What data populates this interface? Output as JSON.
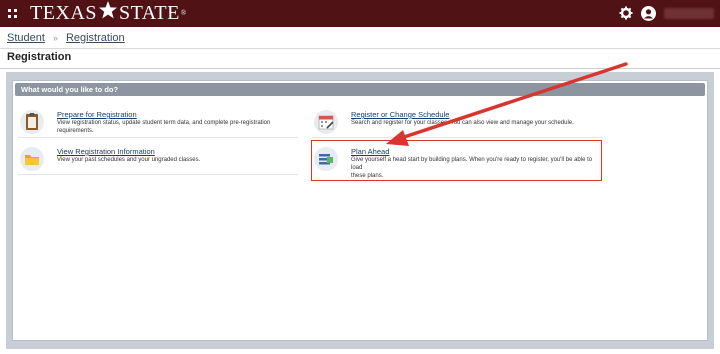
{
  "header": {
    "logo_text_left": "TEXAS",
    "logo_text_right": "STATE",
    "logo_reg": "®",
    "menu_icon": "grid-icon",
    "settings_icon": "gear-icon",
    "user_icon": "user-avatar-icon",
    "colors": {
      "maroon": "#501214"
    }
  },
  "breadcrumb": {
    "items": [
      "Student",
      "Registration"
    ],
    "separator": "»"
  },
  "page": {
    "title": "Registration",
    "section_header": "What would you like to do?"
  },
  "tasks": [
    {
      "label": "Prepare for Registration",
      "description": "View registration status, update student term data, and complete pre-registration requirements.",
      "icon": "clipboard-icon"
    },
    {
      "label": "Register or Change Schedule",
      "description": "Search and register for your classes. You can also view and manage your schedule.",
      "icon": "calendar-edit-icon"
    },
    {
      "label": "View Registration Information",
      "description": "View your past schedules and your ungraded classes.",
      "icon": "folder-icon"
    },
    {
      "label": "Plan Ahead",
      "description_line1": "Give yourself a head start by building plans. When you're ready to register, you'll be able to load",
      "description_line2": "these plans.",
      "icon": "plan-list-icon"
    }
  ],
  "annotation": {
    "color": "#d9352f"
  }
}
